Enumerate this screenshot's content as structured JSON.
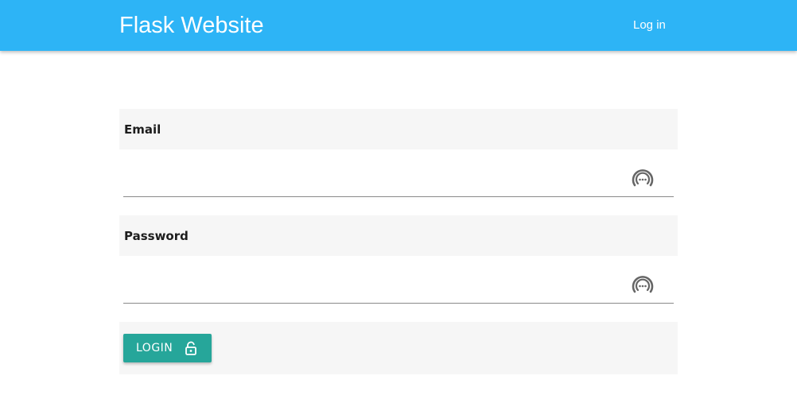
{
  "navbar": {
    "brand": "Flask Website",
    "login_link": "Log in",
    "color": "#2db4f6"
  },
  "form": {
    "email": {
      "label": "Email",
      "value": "",
      "icon": "password-manager-icon"
    },
    "password": {
      "label": "Password",
      "value": "",
      "icon": "password-manager-icon"
    },
    "submit": {
      "label": "LOGIN",
      "icon": "lock-open-icon",
      "color": "#26a69a"
    }
  }
}
